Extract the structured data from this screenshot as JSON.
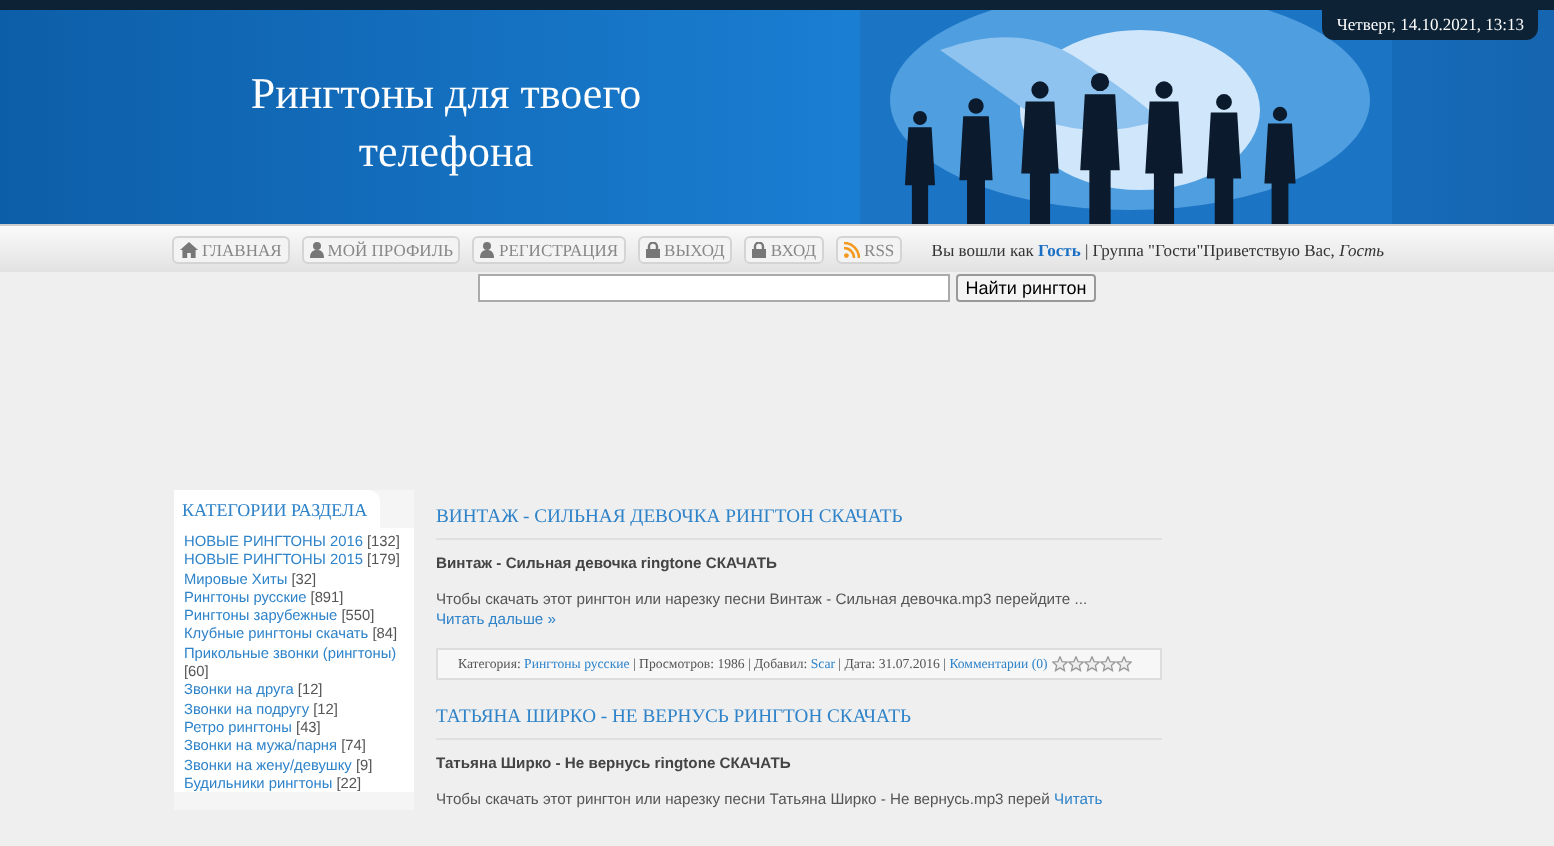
{
  "header": {
    "title": "Рингтоны для твоего телефона",
    "date": "Четверг, 14.10.2021, 13:13"
  },
  "nav": {
    "items": [
      {
        "label": "ГЛАВНАЯ"
      },
      {
        "label": "МОЙ ПРОФИЛЬ"
      },
      {
        "label": "РЕГИСТРАЦИЯ"
      },
      {
        "label": "ВЫХОД"
      },
      {
        "label": "ВХОД"
      },
      {
        "label": "RSS"
      }
    ],
    "greeting": "Вы вошли как **Гость** | Группа \"Гости\"Приветствую Вас, *Гость*"
  },
  "search": {
    "button": "Найти рингтон"
  },
  "sidebar": {
    "title": "КАТЕГОРИИ РАЗДЕЛА",
    "items": [
      {
        "name": "НОВЫЕ РИНГТОНЫ 2016",
        "count": "[132]"
      },
      {
        "name": "НОВЫЕ РИНГТОНЫ 2015",
        "count": "[179]"
      },
      {
        "name": "Мировые Хиты",
        "count": "[32]"
      },
      {
        "name": "Рингтоны русские",
        "count": "[891]"
      },
      {
        "name": "Рингтоны зарубежные",
        "count": "[550]"
      },
      {
        "name": "Клубные рингтоны скачать",
        "count": "[84]"
      },
      {
        "name": "Прикольные звонки (рингтоны)",
        "count": "[60]"
      },
      {
        "name": "Звонки на друга",
        "count": "[12]"
      },
      {
        "name": "Звонки на подругу",
        "count": "[12]"
      },
      {
        "name": "Ретро рингтоны",
        "count": "[43]"
      },
      {
        "name": "Звонки на мужа/парня",
        "count": "[74]"
      },
      {
        "name": "Звонки на жену/девушку",
        "count": "[9]"
      },
      {
        "name": "Будильники рингтоны",
        "count": "[22]"
      }
    ]
  },
  "posts": [
    {
      "title": "ВИНТАЖ - СИЛЬНАЯ ДЕВОЧКА РИНГТОН СКАЧАТЬ",
      "subtitle": "Винтаж - Сильная девочка ringtone СКАЧАТЬ",
      "excerpt": "Чтобы скачать этот рингтон или нарезку песни Винтаж - Сильная девочка.mp3 перейдите ...",
      "more": "Читать дальше »",
      "meta": [
        {
          "kind": "text",
          "text": "Категория:"
        },
        {
          "kind": "link",
          "text": "Рингтоны русские"
        },
        {
          "kind": "text",
          "text": "| Просмотров: 1986 | Добавил:"
        },
        {
          "kind": "link",
          "text": "Scar"
        },
        {
          "kind": "text",
          "text": "| Дата: 31.07.2016 |"
        },
        {
          "kind": "comments",
          "text": "Комментарии (0)"
        }
      ],
      "stars": 0
    },
    {
      "title": "ТАТЬЯНА ШИРКО - НЕ ВЕРНУСЬ РИНГТОН СКАЧАТЬ",
      "subtitle": "Татьяна Ширко - Не вернусь ringtone СКАЧАТЬ",
      "excerpt": "Чтобы скачать этот рингтон или нарезку песни Татьяна Ширко - Не вернусь.mp3 перей",
      "more": "Читать"
    }
  ]
}
